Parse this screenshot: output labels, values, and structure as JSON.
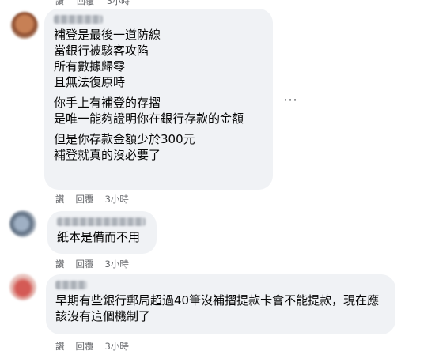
{
  "top_actions": {
    "like": "讚",
    "reply": "回覆",
    "time": "3小時"
  },
  "comments": [
    {
      "lines_a": [
        "補登是最後一道防線",
        "當銀行被駭客攻陷",
        "所有數據歸零",
        "且無法復原時"
      ],
      "lines_b": [
        "你手上有補登的存摺",
        "是唯一能夠證明你在銀行存款的金額"
      ],
      "lines_c": [
        "但是你存款金額少於300元",
        "補登就真的沒必要了"
      ],
      "like": "讚",
      "reply": "回覆",
      "time": "3小時"
    },
    {
      "text": "紙本是備而不用",
      "like": "讚",
      "reply": "回覆",
      "time": "3小時"
    },
    {
      "text": "早期有些銀行郵局超過40筆沒補摺提款卡會不能提款，現在應該沒有這個機制了",
      "like": "讚",
      "reply": "回覆",
      "time": "3小時"
    }
  ],
  "more_icon": "more-options-icon",
  "colors": {
    "bubble": "#f0f2f5",
    "meta": "#65676b",
    "text": "#050505"
  }
}
